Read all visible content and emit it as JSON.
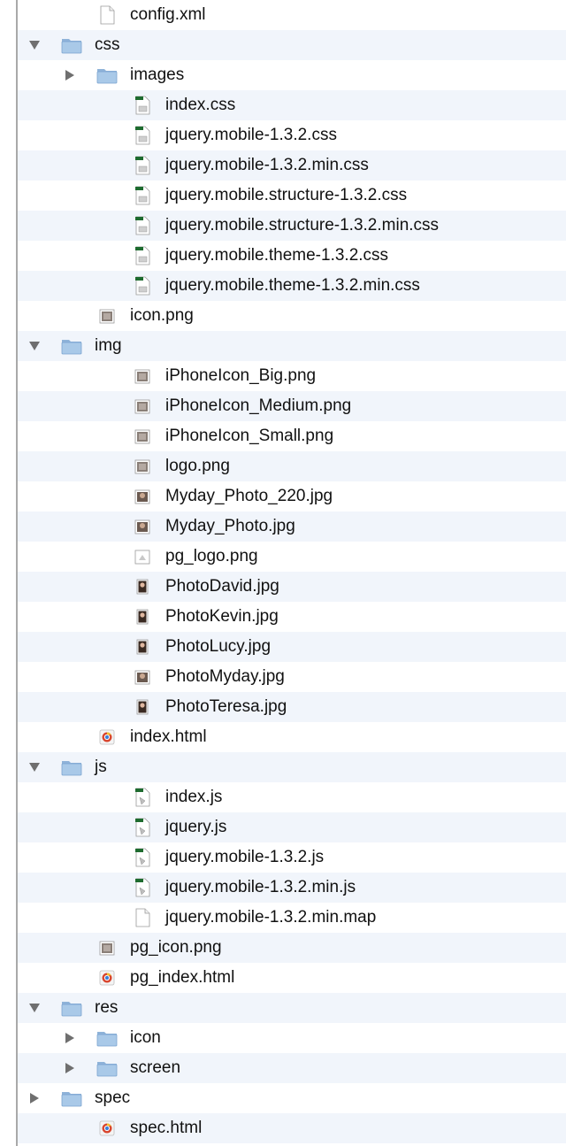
{
  "tree": [
    {
      "label": "config.xml",
      "depth": 1,
      "kind": "file",
      "icon": "xml-file-icon"
    },
    {
      "label": "css",
      "depth": 0,
      "kind": "folder",
      "open": true,
      "icon": "folder-icon"
    },
    {
      "label": "images",
      "depth": 1,
      "kind": "folder",
      "open": false,
      "icon": "folder-icon"
    },
    {
      "label": "index.css",
      "depth": 2,
      "kind": "file",
      "icon": "css-file-icon"
    },
    {
      "label": "jquery.mobile-1.3.2.css",
      "depth": 2,
      "kind": "file",
      "icon": "css-file-icon"
    },
    {
      "label": "jquery.mobile-1.3.2.min.css",
      "depth": 2,
      "kind": "file",
      "icon": "css-file-icon"
    },
    {
      "label": "jquery.mobile.structure-1.3.2.css",
      "depth": 2,
      "kind": "file",
      "icon": "css-file-icon"
    },
    {
      "label": "jquery.mobile.structure-1.3.2.min.css",
      "depth": 2,
      "kind": "file",
      "icon": "css-file-icon"
    },
    {
      "label": "jquery.mobile.theme-1.3.2.css",
      "depth": 2,
      "kind": "file",
      "icon": "css-file-icon"
    },
    {
      "label": "jquery.mobile.theme-1.3.2.min.css",
      "depth": 2,
      "kind": "file",
      "icon": "css-file-icon"
    },
    {
      "label": "icon.png",
      "depth": 1,
      "kind": "file",
      "icon": "image-file-icon"
    },
    {
      "label": "img",
      "depth": 0,
      "kind": "folder",
      "open": true,
      "icon": "folder-icon"
    },
    {
      "label": "iPhoneIcon_Big.png",
      "depth": 2,
      "kind": "file",
      "icon": "image-file-icon"
    },
    {
      "label": "iPhoneIcon_Medium.png",
      "depth": 2,
      "kind": "file",
      "icon": "image-file-icon"
    },
    {
      "label": "iPhoneIcon_Small.png",
      "depth": 2,
      "kind": "file",
      "icon": "image-file-icon"
    },
    {
      "label": "logo.png",
      "depth": 2,
      "kind": "file",
      "icon": "image-file-icon"
    },
    {
      "label": "Myday_Photo_220.jpg",
      "depth": 2,
      "kind": "file",
      "icon": "photo-file-icon"
    },
    {
      "label": "Myday_Photo.jpg",
      "depth": 2,
      "kind": "file",
      "icon": "photo-file-icon"
    },
    {
      "label": "pg_logo.png",
      "depth": 2,
      "kind": "file",
      "icon": "logo-image-icon"
    },
    {
      "label": "PhotoDavid.jpg",
      "depth": 2,
      "kind": "file",
      "icon": "portrait-photo-icon"
    },
    {
      "label": "PhotoKevin.jpg",
      "depth": 2,
      "kind": "file",
      "icon": "portrait-photo-icon"
    },
    {
      "label": "PhotoLucy.jpg",
      "depth": 2,
      "kind": "file",
      "icon": "portrait-photo-icon"
    },
    {
      "label": "PhotoMyday.jpg",
      "depth": 2,
      "kind": "file",
      "icon": "photo-file-icon"
    },
    {
      "label": "PhotoTeresa.jpg",
      "depth": 2,
      "kind": "file",
      "icon": "portrait-photo-icon"
    },
    {
      "label": "index.html",
      "depth": 1,
      "kind": "file",
      "icon": "html-file-icon"
    },
    {
      "label": "js",
      "depth": 0,
      "kind": "folder",
      "open": true,
      "icon": "folder-icon"
    },
    {
      "label": "index.js",
      "depth": 2,
      "kind": "file",
      "icon": "js-file-icon"
    },
    {
      "label": "jquery.js",
      "depth": 2,
      "kind": "file",
      "icon": "js-file-icon"
    },
    {
      "label": "jquery.mobile-1.3.2.js",
      "depth": 2,
      "kind": "file",
      "icon": "js-file-icon"
    },
    {
      "label": "jquery.mobile-1.3.2.min.js",
      "depth": 2,
      "kind": "file",
      "icon": "js-file-icon"
    },
    {
      "label": "jquery.mobile-1.3.2.min.map",
      "depth": 2,
      "kind": "file",
      "icon": "blank-file-icon"
    },
    {
      "label": "pg_icon.png",
      "depth": 1,
      "kind": "file",
      "icon": "image-file-icon"
    },
    {
      "label": "pg_index.html",
      "depth": 1,
      "kind": "file",
      "icon": "html-file-icon"
    },
    {
      "label": "res",
      "depth": 0,
      "kind": "folder",
      "open": true,
      "icon": "folder-icon"
    },
    {
      "label": "icon",
      "depth": 1,
      "kind": "folder",
      "open": false,
      "icon": "folder-icon"
    },
    {
      "label": "screen",
      "depth": 1,
      "kind": "folder",
      "open": false,
      "icon": "folder-icon"
    },
    {
      "label": "spec",
      "depth": 0,
      "kind": "folder",
      "open": false,
      "icon": "folder-icon"
    },
    {
      "label": "spec.html",
      "depth": 1,
      "kind": "file",
      "icon": "html-file-icon"
    }
  ],
  "colors": {
    "row_alt": "#f1f5fb",
    "folder_body": "#a9c9e8",
    "folder_tab": "#8fb3d9",
    "disclosure": "#6f6f6f",
    "css_icon_green": "#1e6b2f",
    "html_icon_red": "#d8452e"
  }
}
